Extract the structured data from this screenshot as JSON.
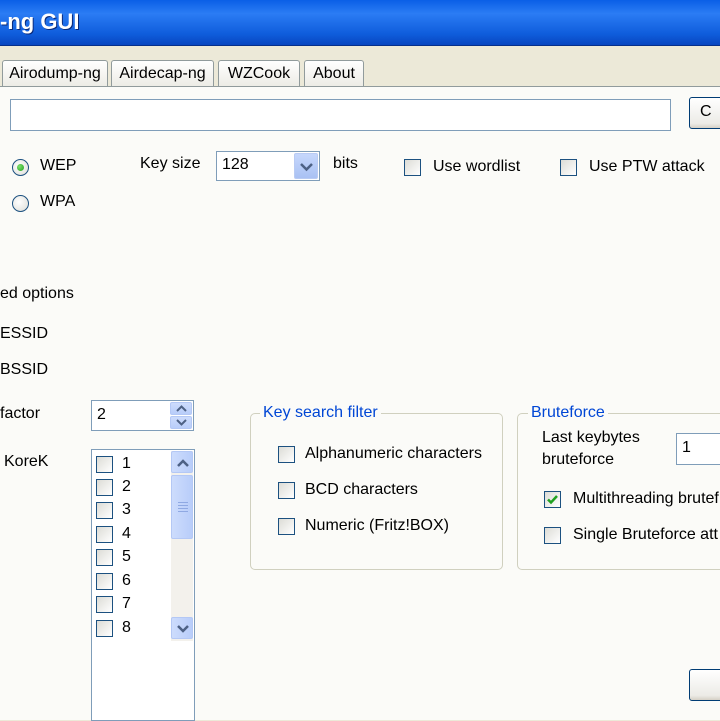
{
  "window": {
    "title": "-ng GUI"
  },
  "tabs": [
    {
      "label": "Airodump-ng"
    },
    {
      "label": "Airdecap-ng"
    },
    {
      "label": "WZCook"
    },
    {
      "label": "About"
    }
  ],
  "file_input": {
    "value": ""
  },
  "open_button": {
    "label": "C"
  },
  "encryption": {
    "options": [
      {
        "label": "WEP",
        "selected": true
      },
      {
        "label": "WPA",
        "selected": false
      }
    ]
  },
  "key_size": {
    "label": "Key size",
    "value": "128",
    "unit": "bits"
  },
  "use_wordlist": {
    "label": "Use wordlist",
    "checked": false
  },
  "use_ptw": {
    "label": "Use PTW attack",
    "checked": false
  },
  "advanced": {
    "label": "ed options",
    "essid_label": "ESSID",
    "bssid_label": "BSSID",
    "factor_label": "factor",
    "factor_value": "2",
    "korek_label": "KoreK",
    "korek_items": [
      {
        "label": "1",
        "checked": false
      },
      {
        "label": "2",
        "checked": false
      },
      {
        "label": "3",
        "checked": false
      },
      {
        "label": "4",
        "checked": false
      },
      {
        "label": "5",
        "checked": false
      },
      {
        "label": "6",
        "checked": false
      },
      {
        "label": "7",
        "checked": false
      },
      {
        "label": "8",
        "checked": false
      }
    ]
  },
  "key_search_filter": {
    "legend": "Key search filter",
    "options": [
      {
        "label": "Alphanumeric characters",
        "checked": false
      },
      {
        "label": "BCD characters",
        "checked": false
      },
      {
        "label": "Numeric (Fritz!BOX)",
        "checked": false
      }
    ]
  },
  "bruteforce": {
    "legend": "Bruteforce",
    "last_keybytes_label_1": "Last keybytes",
    "last_keybytes_label_2": "bruteforce",
    "last_keybytes_value": "1",
    "multithreading": {
      "label": "Multithreading brutef",
      "checked": true
    },
    "single": {
      "label": "Single Bruteforce att",
      "checked": false
    }
  },
  "bottom_button": {
    "label": ""
  }
}
